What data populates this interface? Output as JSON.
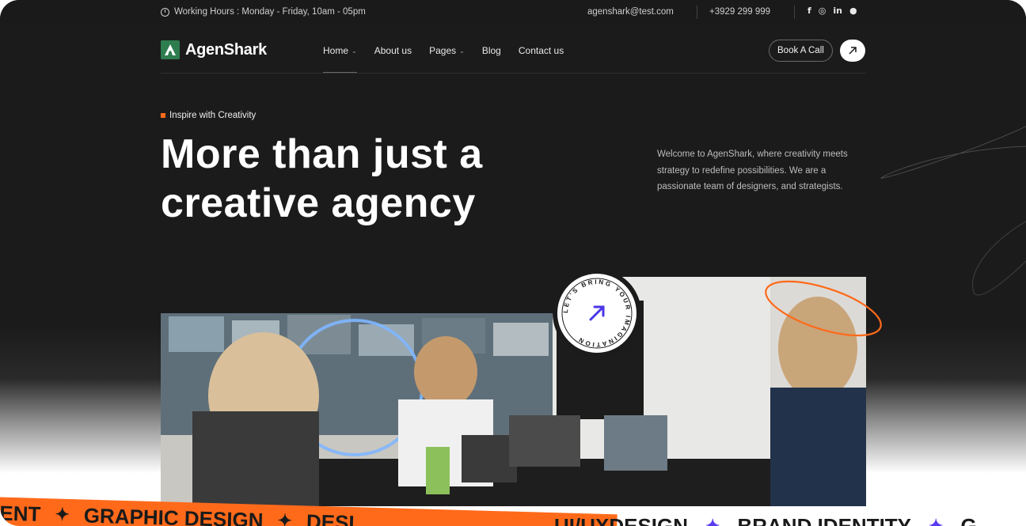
{
  "topbar": {
    "working_hours": "Working Hours : Monday - Friday, 10am - 05pm",
    "email": "agenshark@test.com",
    "phone": "+3929 299 999",
    "socials": [
      "f",
      "◎",
      "in",
      "●"
    ]
  },
  "brand": {
    "name": "AgenShark",
    "logo_icon": "logo-mark-icon",
    "color": "#2e7d4f"
  },
  "nav": {
    "items": [
      {
        "label": "Home",
        "has_dropdown": true,
        "active": true
      },
      {
        "label": "About us",
        "has_dropdown": false
      },
      {
        "label": "Pages",
        "has_dropdown": true
      },
      {
        "label": "Blog",
        "has_dropdown": false
      },
      {
        "label": "Contact us",
        "has_dropdown": false
      }
    ],
    "cta_label": "Book A Call"
  },
  "hero": {
    "tagline": "Inspire with Creativity",
    "headline_line1": "More than just a",
    "headline_line2": "creative agency",
    "intro": "Welcome to AgenShark, where creativity meets strategy to redefine possibilities. We are a passionate team of designers, and strategists.",
    "badge_text": "LET'S BRING YOUR IMAGINATION"
  },
  "ticker": {
    "orange_items": [
      "ENT",
      "GRAPHIC DESIGN",
      "DESI"
    ],
    "white_items": [
      "UI/UXDESIGN",
      "BRAND IDENTITY",
      "G"
    ]
  },
  "colors": {
    "accent": "#ff6a1a",
    "background": "#1c1b1c",
    "star": "#5b3cf0"
  }
}
